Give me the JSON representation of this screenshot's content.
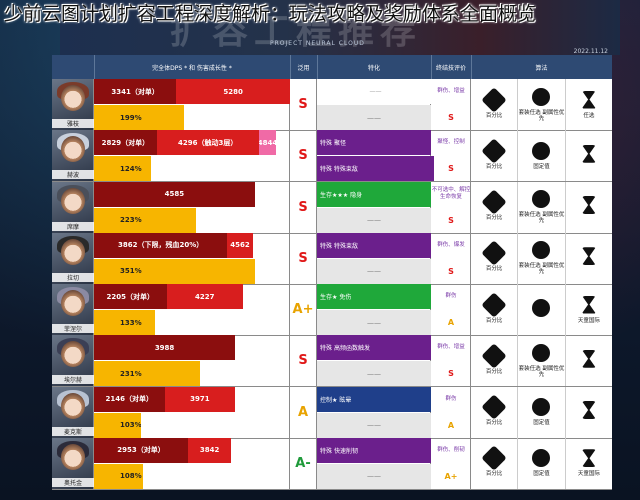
{
  "overlay_title": "少前云图计划扩容工程深度解析：玩法攻略及奖励体系全面概览",
  "banner": {
    "text": "扩容工程推荐",
    "sub": "PROJECT NEURAL CLOUD",
    "date": "2022.11.12"
  },
  "headers": {
    "portrait": "",
    "dps": "完全体DPS * 和 伤害成长性 *",
    "grade": "泛用",
    "feature": "特化",
    "review": "终结技评价",
    "algo": "算法"
  },
  "rows": [
    {
      "name": "雅枝",
      "bar1": "3341（对单）",
      "bar2": "5280",
      "bar3": "",
      "bot": "199%",
      "grade": "S",
      "grade_color": "#e01818",
      "feat_tag": "",
      "feat_text": "",
      "feat_color": "#ffffff",
      "feat_low": "——",
      "rev_top": "群伤、增益",
      "rev_bot": "S",
      "algo": [
        {
          "lab": "百分比"
        },
        {
          "lab": "套装任选 副属性优先"
        },
        {
          "lab": "任选"
        }
      ],
      "hair": "#7a3b2a",
      "bar1_w": 0.42,
      "bar2_w": 0.58,
      "bar3_w": 0,
      "bot_w": 0.46
    },
    {
      "name": "赫波",
      "bar1": "2829（对单）",
      "bar2": "4296（触动3层）",
      "bar3": "4844",
      "bot": "124%",
      "grade": "S",
      "grade_color": "#e01818",
      "feat_tag": "特殊",
      "feat_text": "聚怪",
      "feat_color": "#6b1f8c",
      "feat_low": "特殊 特殊束敌",
      "rev_top": "聚怪、控制",
      "rev_bot": "S",
      "algo": [
        {
          "lab": "百分比"
        },
        {
          "lab": "固定值"
        },
        {
          "lab": ""
        }
      ],
      "hair": "#c8d0dc",
      "bar1_w": 0.32,
      "bar2_w": 0.52,
      "bar3_w": 0.09,
      "bot_w": 0.29
    },
    {
      "name": "席摩",
      "bar1": "4585",
      "bar2": "",
      "bar3": "",
      "bot": "223%",
      "grade": "S",
      "grade_color": "#e01818",
      "feat_tag": "生存★★★",
      "feat_text": "隐身",
      "feat_color": "#1fa83a",
      "feat_low": "——",
      "rev_top": "不可选中、解控 生命恢复",
      "rev_bot": "S",
      "algo": [
        {
          "lab": "百分比"
        },
        {
          "lab": "套装任选 副属性优先"
        },
        {
          "lab": ""
        }
      ],
      "hair": "#4a4f5a",
      "bar1_w": 0.82,
      "bar2_w": 0,
      "bar3_w": 0,
      "bot_w": 0.52
    },
    {
      "name": "拉切",
      "bar1": "3862（下限，残血20%）",
      "bar2": "4562",
      "bar3": "",
      "bot": "351%",
      "grade": "S",
      "grade_color": "#e01818",
      "feat_tag": "特殊",
      "feat_text": "特殊束敌",
      "feat_color": "#6b1f8c",
      "feat_low": "——",
      "rev_top": "群伤、爆发",
      "rev_bot": "S",
      "algo": [
        {
          "lab": "百分比"
        },
        {
          "lab": "套装任选 副属性优先"
        },
        {
          "lab": ""
        }
      ],
      "hair": "#2a2a2a",
      "bar1_w": 0.68,
      "bar2_w": 0.13,
      "bar3_w": 0,
      "bot_w": 0.82
    },
    {
      "name": "菲涅尔",
      "bar1": "2205（对单）",
      "bar2": "4227",
      "bar3": "",
      "bot": "133%",
      "grade": "A+",
      "grade_color": "#e8a300",
      "feat_tag": "生存★",
      "feat_text": "免伤",
      "feat_color": "#1fa83a",
      "feat_low": "——",
      "rev_top": "群伤",
      "rev_bot": "A",
      "algo": [
        {
          "lab": "百分比"
        },
        {
          "lab": ""
        },
        {
          "lab": "天童国际"
        }
      ],
      "hair": "#8b8aa2",
      "bar1_w": 0.37,
      "bar2_w": 0.39,
      "bar3_w": 0,
      "bot_w": 0.31
    },
    {
      "name": "埃尔赫",
      "bar1": "3988",
      "bar2": "",
      "bar3": "",
      "bot": "231%",
      "grade": "S",
      "grade_color": "#e01818",
      "feat_tag": "特殊",
      "feat_text": "高频函数触发",
      "feat_color": "#6b1f8c",
      "feat_low": "——",
      "rev_top": "群伤、增益",
      "rev_bot": "S",
      "algo": [
        {
          "lab": "百分比"
        },
        {
          "lab": "套装任选 副属性优先"
        },
        {
          "lab": ""
        }
      ],
      "hair": "#3b3f55",
      "bar1_w": 0.72,
      "bar2_w": 0,
      "bar3_w": 0,
      "bot_w": 0.54
    },
    {
      "name": "麦克斯",
      "bar1": "2146（对单）",
      "bar2": "3971",
      "bar3": "",
      "bot": "103%",
      "grade": "A",
      "grade_color": "#e8a300",
      "feat_tag": "控制★",
      "feat_text": "眩晕",
      "feat_color": "#1f3f8a",
      "feat_low": "——",
      "rev_top": "群伤",
      "rev_bot": "A",
      "algo": [
        {
          "lab": "百分比"
        },
        {
          "lab": "固定值"
        },
        {
          "lab": ""
        }
      ],
      "hair": "#b8c2d2",
      "bar1_w": 0.36,
      "bar2_w": 0.36,
      "bar3_w": 0,
      "bot_w": 0.24
    },
    {
      "name": "奥托金",
      "bar1": "2953（对单）",
      "bar2": "3842",
      "bar3": "",
      "bot": "108%",
      "grade": "A-",
      "grade_color": "#1f9a3a",
      "feat_tag": "特殊",
      "feat_text": "快速削韧",
      "feat_color": "#6b1f8c",
      "feat_low": "——",
      "rev_top": "群伤、削韧",
      "rev_bot": "A+",
      "algo": [
        {
          "lab": "百分比"
        },
        {
          "lab": "固定值"
        },
        {
          "lab": "天童国际"
        }
      ],
      "hair": "#2b2b3a",
      "bar1_w": 0.48,
      "bar2_w": 0.22,
      "bar3_w": 0,
      "bot_w": 0.25
    }
  ]
}
